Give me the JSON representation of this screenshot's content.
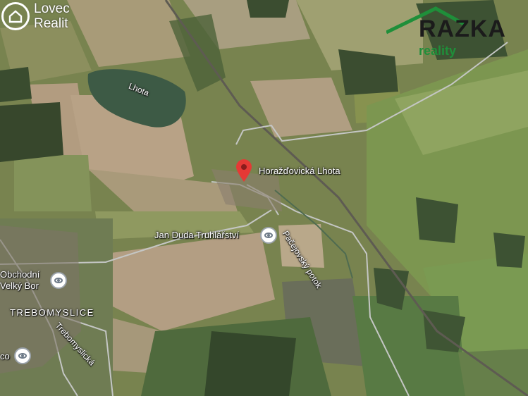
{
  "brand_left": {
    "line1": "Lovec",
    "line2": "Realit"
  },
  "brand_right": {
    "name": "RAZKA",
    "tagline": "reality",
    "color": "#1f8f3a"
  },
  "pin": {
    "label": "Horažďovická Lhota",
    "color": "#e53935"
  },
  "places": [
    {
      "label": "Jan Duda Truhlářství",
      "icon": "eye-icon"
    },
    {
      "label": "Obchodní",
      "label2": "Velký Bor",
      "icon": "eye-icon"
    },
    {
      "label": "TREBOMYSLICE"
    },
    {
      "label": "Lhota"
    },
    {
      "label": "Pačejovský potok"
    },
    {
      "label": "Trebomyslická"
    },
    {
      "label": "co",
      "icon": "eye-icon"
    }
  ]
}
